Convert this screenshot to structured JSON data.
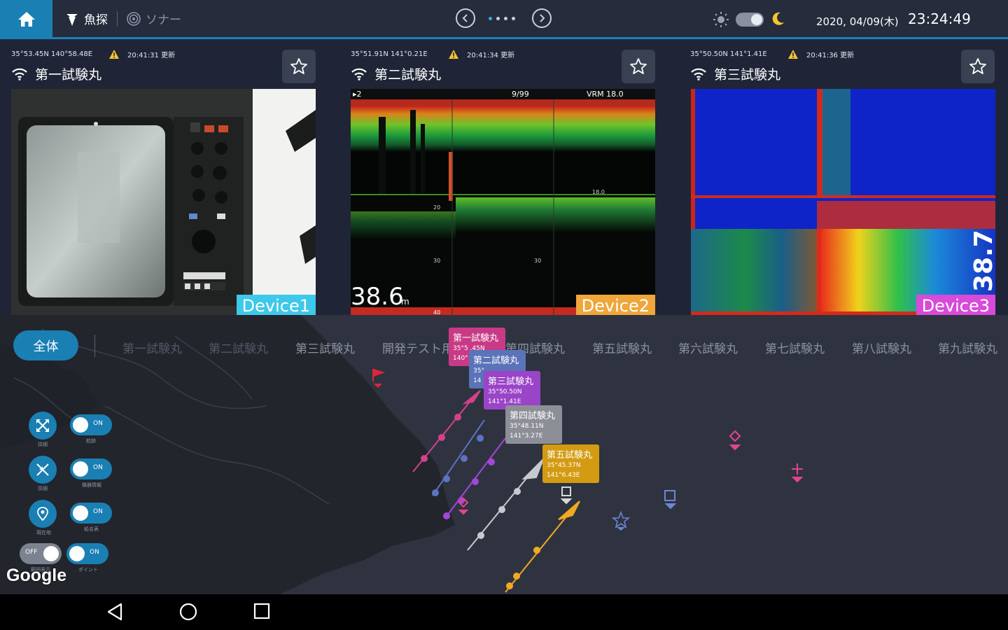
{
  "topbar": {
    "tabs": [
      {
        "label": "魚探",
        "icon": "fish-finder-icon"
      },
      {
        "label": "ソナー",
        "icon": "sonar-icon"
      }
    ],
    "date": "2020, 04/09(木)",
    "time": "23:24:49",
    "theme": "dark"
  },
  "devices": [
    {
      "coords": "35°53.45N 140°58.48E",
      "updated": "20:41:31 更新",
      "name": "第一試験丸",
      "tag": "Device1",
      "tag_color": "#3ec8ea"
    },
    {
      "coords": "35°51.91N 141°0.21E",
      "updated": "20:41:34 更新",
      "name": "第二試験丸",
      "tag": "Device2",
      "tag_color": "#efa63a",
      "screen": {
        "range": "▸2",
        "page": "9/99",
        "vrm": "VRM   18.0",
        "depth": "38.6",
        "unit": "m",
        "scale_a": "20",
        "scale_b": "30",
        "scale_c": "40",
        "mark": "18.0"
      }
    },
    {
      "coords": "35°50.50N 141°1.41E",
      "updated": "20:41:36 更新",
      "name": "第三試験丸",
      "tag": "Device3",
      "tag_color": "#d84ad9",
      "screen": {
        "overlay": "38.7"
      }
    }
  ],
  "map": {
    "all_label": "全体",
    "ship_tabs": [
      "第一試験丸",
      "第二試験丸",
      "第三試験丸",
      "開発テスト用",
      "第四試験丸",
      "第五試験丸",
      "第六試験丸",
      "第七試験丸",
      "第八試験丸",
      "第九試験丸"
    ],
    "popups": [
      {
        "name": "第一試験丸",
        "lat": "35°53.45N",
        "lon": "140°58.48E",
        "lat_shown": "35°5 .45N",
        "lon_shown": "140°",
        "color": "#c83a86"
      },
      {
        "name": "第二試験丸",
        "lat_shown": "35°",
        "lon_shown": "14",
        "color": "#5b73b8"
      },
      {
        "name": "第三試験丸",
        "lat": "35°50.50N",
        "lon": "141°1.41E",
        "lat_shown": "35°50.50N",
        "lon_shown": "141°1.41E",
        "color": "#9a44c8"
      },
      {
        "name": "第四試験丸",
        "lat": "35°48.11N",
        "lon": "141°3.27E",
        "lat_shown": "35°48.11N",
        "lon_shown": "141°3.27E",
        "color": "#8d8f97"
      },
      {
        "name": "第五試験丸",
        "lat": "35°45.37N",
        "lon": "141°6.43E",
        "lat_shown": "35°45.37N",
        "lon_shown": "141°6.43E",
        "color": "#d39b12"
      }
    ],
    "controls": [
      {
        "icon": "expand-icon",
        "caption": "詳細",
        "switch_caption": "航跡",
        "switch": "ON"
      },
      {
        "icon": "collapse-icon",
        "caption": "詳細",
        "switch_caption": "機器情報",
        "switch": "ON"
      },
      {
        "icon": "location-pin-icon",
        "caption": "現在地",
        "switch_caption": "船名表",
        "switch": "ON"
      },
      {
        "switch_left": "OFF",
        "caption_left": "範囲表示",
        "switch": "ON",
        "switch_caption": "ポイント"
      }
    ],
    "attribution": "Google"
  },
  "colors": {
    "accent": "#1a7fb3",
    "topbar": "#262c3c",
    "card": "#1f2536",
    "map_sea": "#2f3340"
  }
}
